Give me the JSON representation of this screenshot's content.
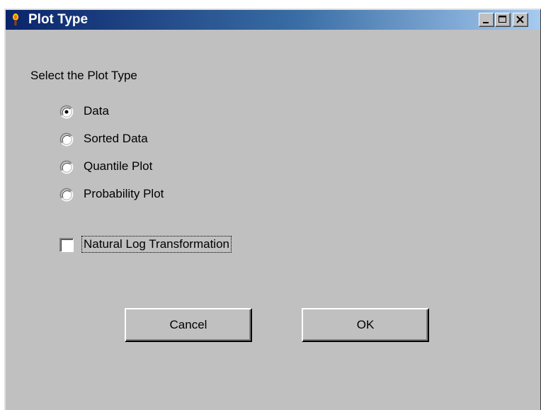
{
  "window": {
    "title": "Plot Type",
    "icon": "torch-icon",
    "controls": [
      "minimize-icon",
      "maximize-icon",
      "close-icon"
    ]
  },
  "dialog": {
    "heading": "Select the Plot Type",
    "plot_types": [
      {
        "label": "Data",
        "selected": true
      },
      {
        "label": "Sorted Data",
        "selected": false
      },
      {
        "label": "Quantile Plot",
        "selected": false
      },
      {
        "label": "Probability Plot",
        "selected": false
      }
    ],
    "log_transform": {
      "label": "Natural Log Transformation",
      "checked": false
    },
    "buttons": {
      "cancel_label": "Cancel",
      "ok_label": "OK"
    }
  },
  "colors": {
    "face": "#c0c0c0",
    "title_start": "#0a246a",
    "title_end": "#a6caf0"
  }
}
